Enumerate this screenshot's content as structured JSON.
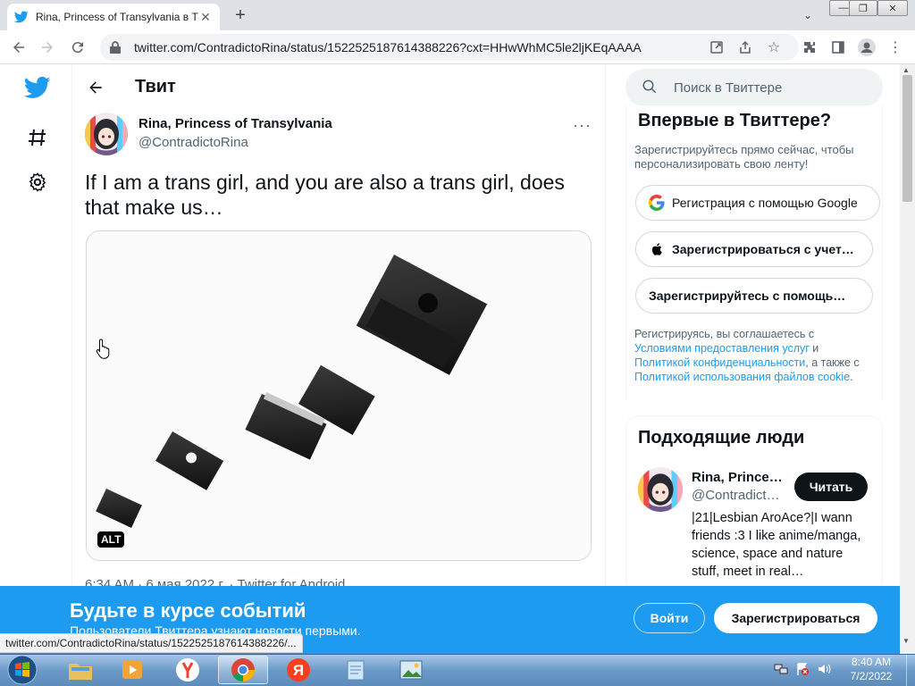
{
  "browser": {
    "tab_title": "Rina, Princess of Transylvania в Т",
    "url": "twitter.com/ContradictoRina/status/1522525187614388226?cxt=HHwWhMC5le2ljKEqAAAA",
    "minimize": "—",
    "restore": "❐",
    "close": "✕"
  },
  "header": {
    "title": "Твит"
  },
  "tweet": {
    "author_name": "Rina, Princess of Transylvania",
    "author_handle": "@ContradictoRina",
    "text": "If I am a trans girl, and you are also a trans girl, does that make us…",
    "alt_badge": "ALT",
    "meta": "6:34 AM · 6 мая 2022 г. · Twitter for Android",
    "more": "···"
  },
  "search": {
    "placeholder": "Поиск в Твиттере"
  },
  "signup": {
    "title": "Впервые в Твиттере?",
    "subtitle": "Зарегистрируйтесь прямо сейчас, чтобы персонализировать свою ленту!",
    "google": "Регистрация с помощью Google",
    "apple": "Зарегистрироваться с учет…",
    "email": "Зарегистрируйтесь с помощь…",
    "terms_prefix": "Регистрируясь, вы соглашаетесь с",
    "terms_link": "Условиями предоставления услуг",
    "terms_and": "и",
    "privacy_link": "Политикой конфиденциальности",
    "privacy_after": ", а также с",
    "cookie_link": "Политикой использования файлов cookie",
    "cookie_after": "."
  },
  "people": {
    "title": "Подходящие люди",
    "name": "Rina, Prince…",
    "handle": "@Contradict…",
    "follow": "Читать",
    "bio": "|21|Lesbian AroAce?|I wann friends :3 I like anime/manga, science, space and nature stuff, meet in real…"
  },
  "banner": {
    "title": "Будьте в курсе событий",
    "subtitle": "Пользователи Твиттера узнают новости первыми.",
    "login": "Войти",
    "register": "Зарегистрироваться"
  },
  "status_bar": {
    "url": "twitter.com/ContradictoRina/status/1522525187614388226/..."
  },
  "taskbar": {
    "time": "8:40 AM",
    "date": "7/2/2022"
  },
  "colors": {
    "accent": "#1d9bf0",
    "text": "#0f1419",
    "muted": "#536471"
  }
}
